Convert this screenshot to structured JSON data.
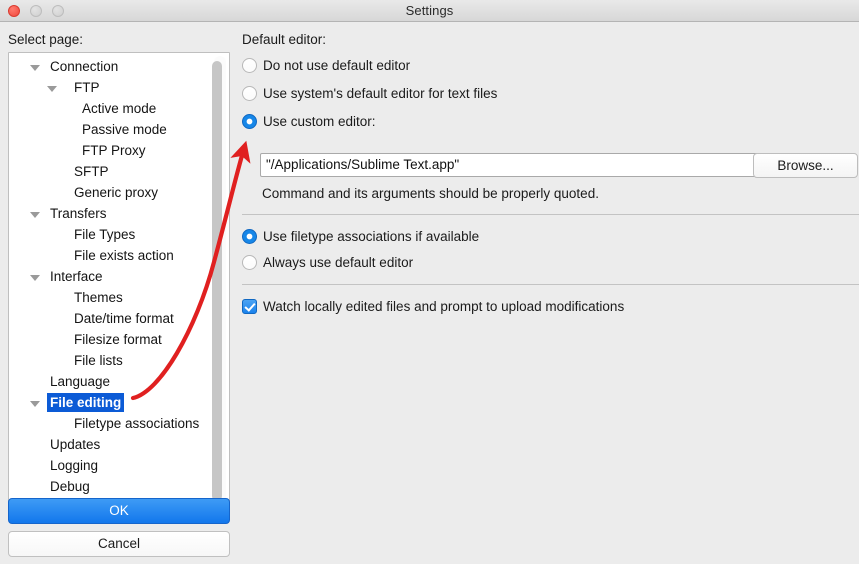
{
  "window": {
    "title": "Settings",
    "controls": {
      "close": "close-button",
      "minimize": "minimize-button",
      "maximize": "maximize-button"
    }
  },
  "left": {
    "label": "Select page:",
    "tree": [
      {
        "label": "Connection",
        "level": 0,
        "expandable": true,
        "selected": false
      },
      {
        "label": "FTP",
        "level": 1,
        "expandable": true,
        "selected": false
      },
      {
        "label": "Active mode",
        "level": 2,
        "expandable": false,
        "selected": false
      },
      {
        "label": "Passive mode",
        "level": 2,
        "expandable": false,
        "selected": false
      },
      {
        "label": "FTP Proxy",
        "level": 2,
        "expandable": false,
        "selected": false
      },
      {
        "label": "SFTP",
        "level": 1,
        "expandable": false,
        "selected": false
      },
      {
        "label": "Generic proxy",
        "level": 1,
        "expandable": false,
        "selected": false
      },
      {
        "label": "Transfers",
        "level": 0,
        "expandable": true,
        "selected": false
      },
      {
        "label": "File Types",
        "level": 1,
        "expandable": false,
        "selected": false
      },
      {
        "label": "File exists action",
        "level": 1,
        "expandable": false,
        "selected": false
      },
      {
        "label": "Interface",
        "level": 0,
        "expandable": true,
        "selected": false
      },
      {
        "label": "Themes",
        "level": 1,
        "expandable": false,
        "selected": false
      },
      {
        "label": "Date/time format",
        "level": 1,
        "expandable": false,
        "selected": false
      },
      {
        "label": "Filesize format",
        "level": 1,
        "expandable": false,
        "selected": false
      },
      {
        "label": "File lists",
        "level": 1,
        "expandable": false,
        "selected": false
      },
      {
        "label": "Language",
        "level": 0,
        "expandable": false,
        "selected": false
      },
      {
        "label": "File editing",
        "level": 0,
        "expandable": true,
        "selected": true
      },
      {
        "label": "Filetype associations",
        "level": 1,
        "expandable": false,
        "selected": false
      },
      {
        "label": "Updates",
        "level": 0,
        "expandable": false,
        "selected": false
      },
      {
        "label": "Logging",
        "level": 0,
        "expandable": false,
        "selected": false
      },
      {
        "label": "Debug",
        "level": 0,
        "expandable": false,
        "selected": false
      }
    ],
    "buttons": {
      "ok": "OK",
      "cancel": "Cancel"
    }
  },
  "right": {
    "section_label": "Default editor:",
    "editor_radios": [
      {
        "label": "Do not use default editor",
        "selected": false
      },
      {
        "label": "Use system's default editor for text files",
        "selected": false
      },
      {
        "label": "Use custom editor:",
        "selected": true
      }
    ],
    "editor_path": "\"/Applications/Sublime Text.app\"",
    "editor_path_placeholder": "",
    "browse_label": "Browse...",
    "hint": "Command and its arguments should be properly quoted.",
    "association_radios": [
      {
        "label": "Use filetype associations if available",
        "selected": true
      },
      {
        "label": "Always use default editor",
        "selected": false
      }
    ],
    "watch_checkbox": {
      "label": "Watch locally edited files and prompt to upload modifications",
      "checked": true
    }
  },
  "annotation": {
    "type": "arrow",
    "color": "#e02020",
    "points_to": "editor-path-field",
    "origin": "file-editing-tree-item"
  },
  "colors": {
    "accent_blue": "#1277ec",
    "selection_blue": "#0c5bd6",
    "annotation_red": "#e02020",
    "window_bg": "#ececec",
    "panel_bg": "#ffffff"
  }
}
